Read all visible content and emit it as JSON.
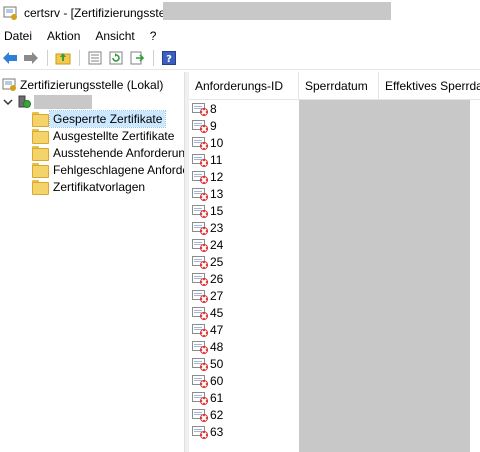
{
  "window": {
    "title": "certsrv - [Zertifizierungsstelle"
  },
  "menu": [
    "Datei",
    "Aktion",
    "Ansicht",
    "?"
  ],
  "toolbar": {
    "buttons": [
      "back-icon",
      "forward-icon",
      "up-folder-icon",
      "properties-icon",
      "refresh-icon",
      "export-list-icon",
      "help-icon"
    ]
  },
  "tree": {
    "root_label": "Zertifizierungsstelle (Lokal)",
    "items": [
      {
        "label": "Gesperrte Zertifikate",
        "selected": true
      },
      {
        "label": "Ausgestellte Zertifikate"
      },
      {
        "label": "Ausstehende Anforderungen"
      },
      {
        "label": "Fehlgeschlagene Anforderungen"
      },
      {
        "label": "Zertifikatvorlagen"
      }
    ]
  },
  "list": {
    "columns": [
      "Anforderungs-ID",
      "Sperrdatum",
      "Effektives Sperrdatum"
    ],
    "rows": [
      "8",
      "9",
      "10",
      "11",
      "12",
      "13",
      "15",
      "23",
      "24",
      "25",
      "26",
      "27",
      "45",
      "47",
      "48",
      "50",
      "60",
      "61",
      "62",
      "63"
    ]
  },
  "colors": {
    "selection": "#cce8ff",
    "redaction": "#c8c8c8",
    "folder": "#f5d36b"
  }
}
